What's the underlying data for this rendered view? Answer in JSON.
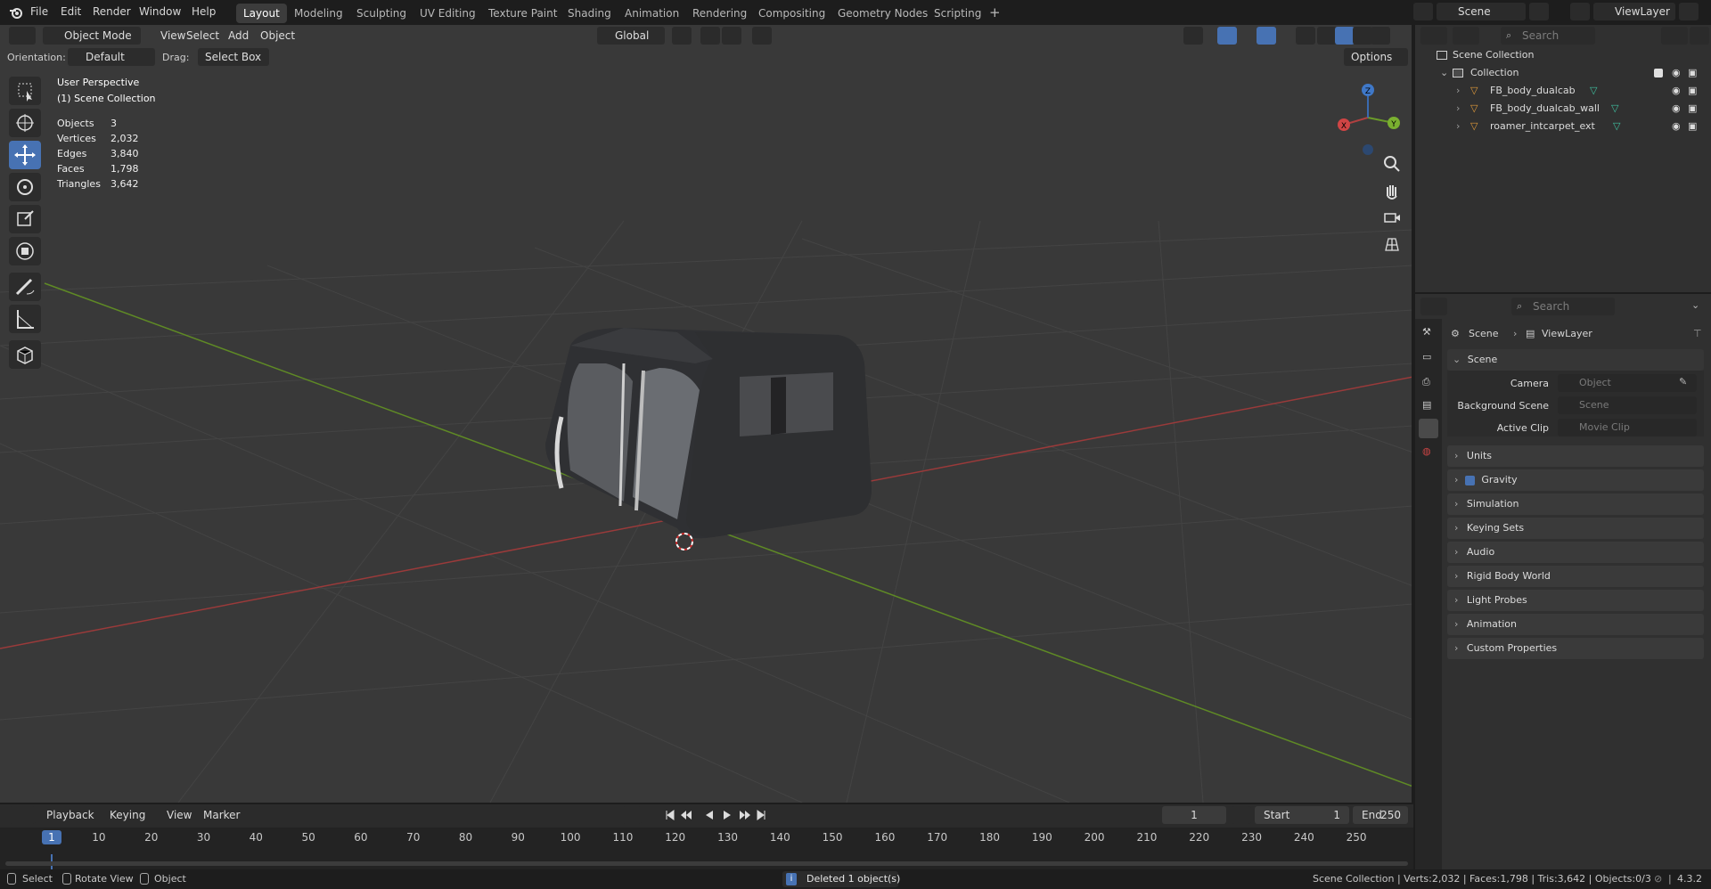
{
  "topbar": {
    "menus": [
      "File",
      "Edit",
      "Render",
      "Window",
      "Help"
    ],
    "workspace_tabs": [
      "Layout",
      "Modeling",
      "Sculpting",
      "UV Editing",
      "Texture Paint",
      "Shading",
      "Animation",
      "Rendering",
      "Compositing",
      "Geometry Nodes",
      "Scripting"
    ],
    "active_tab": "Layout",
    "scene_name": "Scene",
    "view_layer": "ViewLayer"
  },
  "viewport_header": {
    "mode": "Object Mode",
    "menus": [
      "View",
      "Select",
      "Add",
      "Object"
    ],
    "transform_orientation": "Global"
  },
  "tool_settings": {
    "orientation_label": "Orientation:",
    "orientation_value": "Default",
    "drag_label": "Drag:",
    "drag_value": "Select Box",
    "options_label": "Options"
  },
  "viewport_overlay": {
    "view_name": "User Perspective",
    "collection": "(1) Scene Collection",
    "stats": [
      {
        "label": "Objects",
        "value": "3"
      },
      {
        "label": "Vertices",
        "value": "2,032"
      },
      {
        "label": "Edges",
        "value": "3,840"
      },
      {
        "label": "Faces",
        "value": "1,798"
      },
      {
        "label": "Triangles",
        "value": "3,642"
      }
    ]
  },
  "gizmo": {
    "x": "X",
    "y": "Y",
    "z": "Z"
  },
  "colors": {
    "x_axis": "#b04040",
    "y_axis": "#6a9a2a",
    "accent": "#4772b3",
    "mesh_orange": "#e09a3a"
  },
  "timeline": {
    "menus": [
      "Playback",
      "Keying",
      "View",
      "Marker"
    ],
    "current_frame": "1",
    "start_label": "Start",
    "start_value": "1",
    "end_label": "End",
    "end_value": "250",
    "frame_numbers": [
      "1",
      "10",
      "20",
      "30",
      "40",
      "50",
      "60",
      "70",
      "80",
      "90",
      "100",
      "110",
      "120",
      "130",
      "140",
      "150",
      "160",
      "170",
      "180",
      "190",
      "200",
      "210",
      "220",
      "230",
      "240",
      "250"
    ]
  },
  "statusbar": {
    "select": "Select",
    "rotate": "Rotate View",
    "object": "Object",
    "message": "Deleted 1 object(s)",
    "stats": "Scene Collection | Verts:2,032 | Faces:1,798 | Tris:3,642 | Objects:0/3",
    "version": "4.3.2"
  },
  "outliner": {
    "search_placeholder": "Search",
    "scene_collection": "Scene Collection",
    "collection": "Collection",
    "objects": [
      "FB_body_dualcab",
      "FB_body_dualcab_wall",
      "roamer_intcarpet_ext"
    ]
  },
  "properties": {
    "search_placeholder": "Search",
    "breadcrumb_scene": "Scene",
    "breadcrumb_layer": "ViewLayer",
    "scene_panel": "Scene",
    "camera_label": "Camera",
    "camera_placeholder": "Object",
    "bg_scene_label": "Background Scene",
    "bg_scene_placeholder": "Scene",
    "active_clip_label": "Active Clip",
    "active_clip_placeholder": "Movie Clip",
    "panels": [
      "Units",
      "Gravity",
      "Simulation",
      "Keying Sets",
      "Audio",
      "Rigid Body World",
      "Light Probes",
      "Animation",
      "Custom Properties"
    ]
  }
}
